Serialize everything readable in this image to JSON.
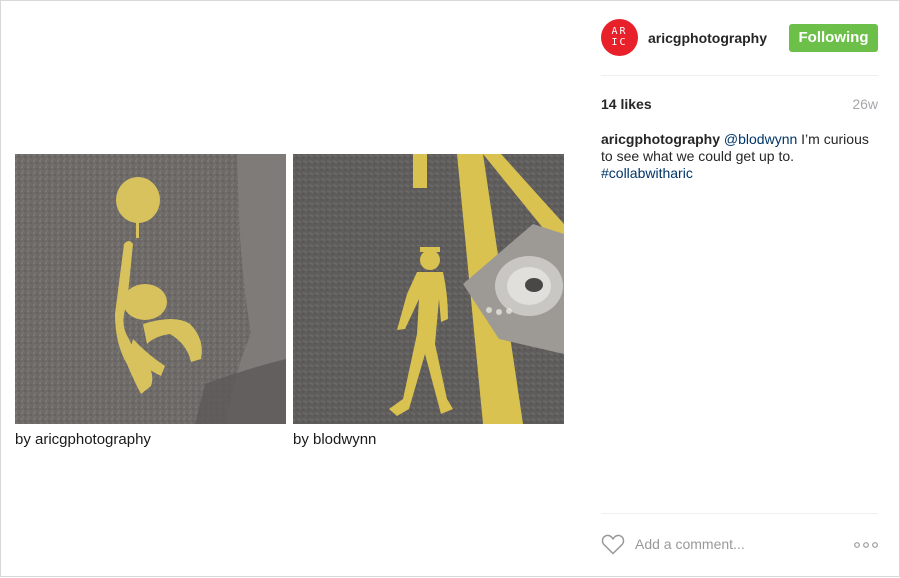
{
  "post": {
    "images": [
      {
        "caption": "by aricgphotography"
      },
      {
        "caption": "by blodwynn"
      }
    ]
  },
  "header": {
    "avatar_text": [
      "AR",
      "IC"
    ],
    "username": "aricgphotography",
    "follow_label": "Following"
  },
  "stats": {
    "likes": "14 likes",
    "age": "26w"
  },
  "comment": {
    "author": "aricgphotography",
    "mention": "@blodwynn",
    "text": " I’m curious to see what we could get up to.",
    "hashtag": "#collabwitharic"
  },
  "footer": {
    "comment_placeholder": "Add a comment..."
  },
  "icons": {
    "like": "heart-icon",
    "more": "more-options-icon"
  },
  "colors": {
    "follow_button": "#6cc04a",
    "avatar": "#e8202a",
    "link": "#003569"
  }
}
